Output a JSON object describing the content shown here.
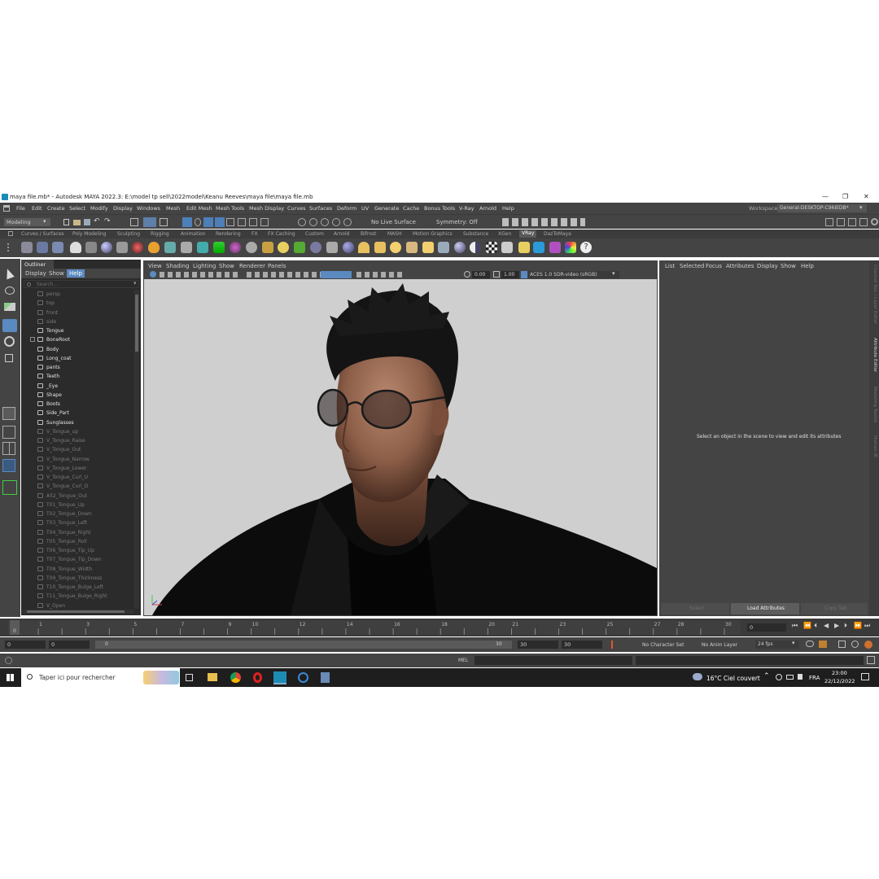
{
  "titlebar": {
    "title": "maya file.mb* - Autodesk MAYA 2022.3: E:\\model tp sell\\2022model\\Keanu Reeves\\maya file\\maya file.mb",
    "minimize": "—",
    "restore": "❐",
    "close": "✕"
  },
  "menubar": {
    "items": [
      "File",
      "Edit",
      "Create",
      "Select",
      "Modify",
      "Display",
      "Windows",
      "Mesh",
      "Edit Mesh",
      "Mesh Tools",
      "Mesh Display",
      "Curves",
      "Surfaces",
      "Deform",
      "UV",
      "Generate",
      "Cache",
      "Bonus Tools",
      "V-Ray",
      "Arnold",
      "Help"
    ],
    "workspace_label": "Workspace:",
    "workspace_value": "General-DESKTOP-C96IEDB*"
  },
  "statusline": {
    "mode": "Modeling",
    "live_surface": "No Live Surface",
    "symmetry": "Symmetry: Off"
  },
  "shelf_tabs": [
    "Curves / Surfaces",
    "Poly Modeling",
    "Sculpting",
    "Rigging",
    "Animation",
    "Rendering",
    "FX",
    "FX Caching",
    "Custom",
    "Arnold",
    "Bifrost",
    "MASH",
    "Motion Graphics",
    "Substance",
    "XGen",
    "VRay",
    "DazToMaya"
  ],
  "shelf_active": "VRay",
  "outliner": {
    "title": "Outliner",
    "menu": [
      "Display",
      "Show",
      "Help"
    ],
    "search_placeholder": "Search...",
    "items": [
      {
        "label": "persp",
        "dim": true
      },
      {
        "label": "top",
        "dim": true
      },
      {
        "label": "front",
        "dim": true
      },
      {
        "label": "side",
        "dim": true
      },
      {
        "label": "Tongue",
        "dim": false
      },
      {
        "label": "BoneRoot",
        "dim": false
      },
      {
        "label": "Body",
        "dim": false
      },
      {
        "label": "Long_coat",
        "dim": false
      },
      {
        "label": "pants",
        "dim": false
      },
      {
        "label": "Teeth",
        "dim": false
      },
      {
        "label": "_Eye",
        "dim": false
      },
      {
        "label": "Shape",
        "dim": false
      },
      {
        "label": "Boots",
        "dim": false
      },
      {
        "label": "Side_Part",
        "dim": false
      },
      {
        "label": "Sunglasses",
        "dim": false
      },
      {
        "label": "V_Tongue_up",
        "dim": true
      },
      {
        "label": "V_Tongue_Raise",
        "dim": true
      },
      {
        "label": "V_Tongue_Out",
        "dim": true
      },
      {
        "label": "V_Tongue_Narrow",
        "dim": true
      },
      {
        "label": "V_Tongue_Lower",
        "dim": true
      },
      {
        "label": "V_Tongue_Curl_U",
        "dim": true
      },
      {
        "label": "V_Tongue_Curl_D",
        "dim": true
      },
      {
        "label": "A52_Tongue_Out",
        "dim": true
      },
      {
        "label": "T01_Tongue_Up",
        "dim": true
      },
      {
        "label": "T02_Tongue_Down",
        "dim": true
      },
      {
        "label": "T03_Tongue_Left",
        "dim": true
      },
      {
        "label": "T04_Tongue_Right",
        "dim": true
      },
      {
        "label": "T05_Tongue_Roll",
        "dim": true
      },
      {
        "label": "T06_Tongue_Tip_Up",
        "dim": true
      },
      {
        "label": "T07_Tongue_Tip_Down",
        "dim": true
      },
      {
        "label": "T08_Tongue_Width",
        "dim": true
      },
      {
        "label": "T09_Tongue_Thickness",
        "dim": true
      },
      {
        "label": "T10_Tongue_Bulge_Left",
        "dim": true
      },
      {
        "label": "T11_Tongue_Bulge_Right",
        "dim": true
      },
      {
        "label": "V_Open",
        "dim": true
      }
    ]
  },
  "viewport": {
    "menu": [
      "View",
      "Shading",
      "Lighting",
      "Show",
      "Renderer",
      "Panels"
    ],
    "exposure": "0.00",
    "gamma": "1.00",
    "colorspace": "ACES 1.0 SDR-video (sRGB)"
  },
  "attribute_editor": {
    "menu": [
      "List",
      "Selected",
      "Focus",
      "Attributes",
      "Display",
      "Show",
      "Help"
    ],
    "message": "Select an object in the scene to view and edit its attributes",
    "buttons": [
      "Select",
      "Load Attributes",
      "Copy Tab"
    ]
  },
  "right_strip": [
    "Channel Box / Layer Editor",
    "Attribute Editor",
    "Modeling Toolkit",
    "Human IK"
  ],
  "timeslider": {
    "ticks": [
      0,
      1,
      2,
      3,
      4,
      5,
      6,
      7,
      8,
      9,
      10,
      11,
      12,
      13,
      14,
      15,
      16,
      17,
      18,
      19,
      20,
      21,
      22,
      23,
      24,
      25,
      26,
      27,
      28,
      29,
      30
    ],
    "tick_labels": [
      "1",
      "3",
      "5",
      "7",
      "9",
      "10",
      "12",
      "14",
      "16",
      "18",
      "20",
      "21",
      "23",
      "25",
      "27",
      "28",
      "30"
    ],
    "current_frame": "0",
    "current_marker": "0"
  },
  "rangeslider": {
    "start": "0",
    "anim_start": "0",
    "range_start": "0",
    "range_end": "30",
    "anim_end": "30",
    "end": "30",
    "character_set": "No Character Set",
    "anim_layer": "No Anim Layer",
    "fps": "24 fps"
  },
  "cmdline": {
    "label": "MEL"
  },
  "taskbar": {
    "search_placeholder": "Taper ici pour rechercher",
    "weather": "16°C  Ciel couvert",
    "language": "FRA",
    "time": "23:00",
    "date": "22/12/2022"
  }
}
